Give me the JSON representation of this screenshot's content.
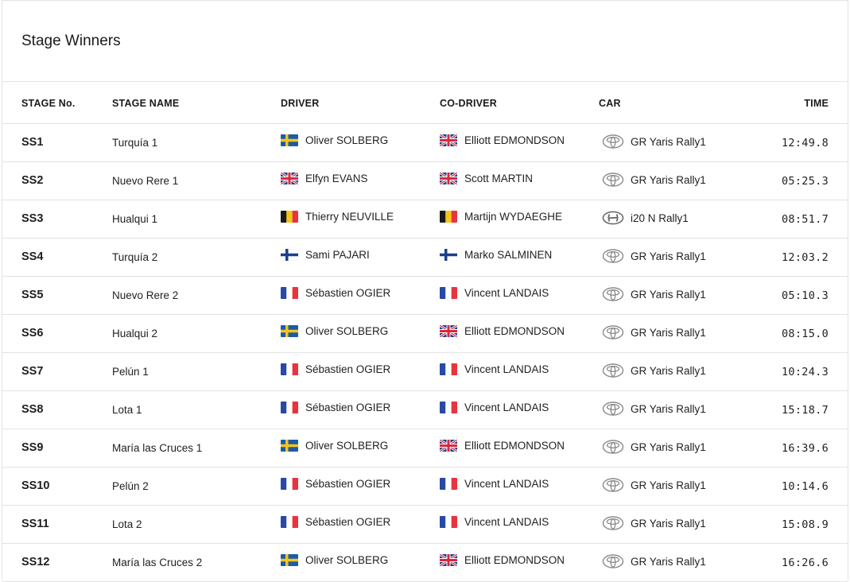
{
  "title": "Stage Winners",
  "columns": {
    "stage_no": "STAGE No.",
    "stage_name": "STAGE NAME",
    "driver": "DRIVER",
    "co_driver": "CO-DRIVER",
    "car": "CAR",
    "time": "TIME"
  },
  "rows": [
    {
      "stage": "SS1",
      "name": "Turquía 1",
      "driver": "Oliver SOLBERG",
      "driver_flag": "sweden",
      "co_driver": "Elliott EDMONDSON",
      "co_driver_flag": "uk",
      "car": "GR Yaris Rally1",
      "car_logo": "toyota-logo",
      "time": "12:49.8"
    },
    {
      "stage": "SS2",
      "name": "Nuevo Rere 1",
      "driver": "Elfyn EVANS",
      "driver_flag": "uk",
      "co_driver": "Scott MARTIN",
      "co_driver_flag": "uk",
      "car": "GR Yaris Rally1",
      "car_logo": "toyota-logo",
      "time": "05:25.3"
    },
    {
      "stage": "SS3",
      "name": "Hualqui 1",
      "driver": "Thierry NEUVILLE",
      "driver_flag": "belgium",
      "co_driver": "Martijn WYDAEGHE",
      "co_driver_flag": "belgium",
      "car": "i20 N Rally1",
      "car_logo": "hyundai-logo",
      "time": "08:51.7"
    },
    {
      "stage": "SS4",
      "name": "Turquía 2",
      "driver": "Sami PAJARI",
      "driver_flag": "finland",
      "co_driver": "Marko SALMINEN",
      "co_driver_flag": "finland",
      "car": "GR Yaris Rally1",
      "car_logo": "toyota-logo",
      "time": "12:03.2"
    },
    {
      "stage": "SS5",
      "name": "Nuevo Rere 2",
      "driver": "Sébastien OGIER",
      "driver_flag": "france",
      "co_driver": "Vincent LANDAIS",
      "co_driver_flag": "france",
      "car": "GR Yaris Rally1",
      "car_logo": "toyota-logo",
      "time": "05:10.3"
    },
    {
      "stage": "SS6",
      "name": "Hualqui 2",
      "driver": "Oliver SOLBERG",
      "driver_flag": "sweden",
      "co_driver": "Elliott EDMONDSON",
      "co_driver_flag": "uk",
      "car": "GR Yaris Rally1",
      "car_logo": "toyota-logo",
      "time": "08:15.0"
    },
    {
      "stage": "SS7",
      "name": "Pelún 1",
      "driver": "Sébastien OGIER",
      "driver_flag": "france",
      "co_driver": "Vincent LANDAIS",
      "co_driver_flag": "france",
      "car": "GR Yaris Rally1",
      "car_logo": "toyota-logo",
      "time": "10:24.3"
    },
    {
      "stage": "SS8",
      "name": "Lota 1",
      "driver": "Sébastien OGIER",
      "driver_flag": "france",
      "co_driver": "Vincent LANDAIS",
      "co_driver_flag": "france",
      "car": "GR Yaris Rally1",
      "car_logo": "toyota-logo",
      "time": "15:18.7"
    },
    {
      "stage": "SS9",
      "name": "María las Cruces 1",
      "driver": "Oliver SOLBERG",
      "driver_flag": "sweden",
      "co_driver": "Elliott EDMONDSON",
      "co_driver_flag": "uk",
      "car": "GR Yaris Rally1",
      "car_logo": "toyota-logo",
      "time": "16:39.6"
    },
    {
      "stage": "SS10",
      "name": "Pelún 2",
      "driver": "Sébastien OGIER",
      "driver_flag": "france",
      "co_driver": "Vincent LANDAIS",
      "co_driver_flag": "france",
      "car": "GR Yaris Rally1",
      "car_logo": "toyota-logo",
      "time": "10:14.6"
    },
    {
      "stage": "SS11",
      "name": "Lota 2",
      "driver": "Sébastien OGIER",
      "driver_flag": "france",
      "co_driver": "Vincent LANDAIS",
      "co_driver_flag": "france",
      "car": "GR Yaris Rally1",
      "car_logo": "toyota-logo",
      "time": "15:08.9"
    },
    {
      "stage": "SS12",
      "name": "María las Cruces 2",
      "driver": "Oliver SOLBERG",
      "driver_flag": "sweden",
      "co_driver": "Elliott EDMONDSON",
      "co_driver_flag": "uk",
      "car": "GR Yaris Rally1",
      "car_logo": "toyota-logo",
      "time": "16:26.6"
    }
  ]
}
